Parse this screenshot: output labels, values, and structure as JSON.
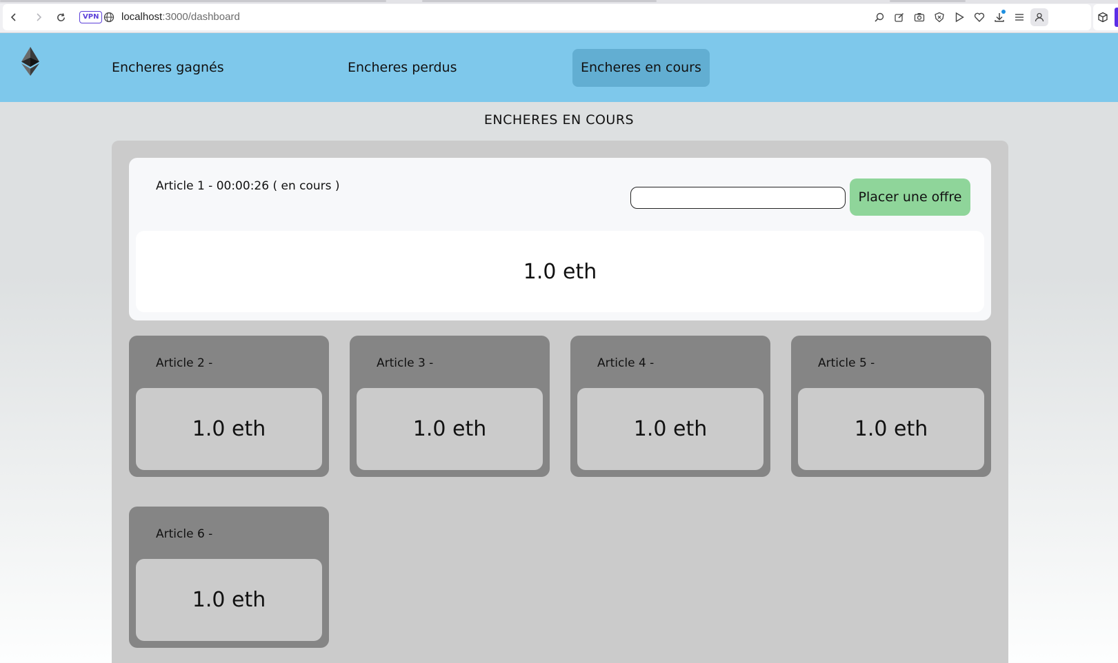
{
  "browser": {
    "url_host": "localhost",
    "url_path": ":3000/dashboard",
    "vpn_label": "VPN",
    "toolbar_icons": [
      "zoom-icon",
      "edit-icon",
      "screenshot-icon",
      "shield-icon",
      "play-icon",
      "heart-icon",
      "download-icon",
      "menu-icon",
      "profile-icon"
    ]
  },
  "nav": {
    "logo": "ethereum-logo",
    "links": [
      {
        "label": "Encheres gagnés",
        "active": false
      },
      {
        "label": "Encheres perdus",
        "active": false
      },
      {
        "label": "Encheres en cours",
        "active": true
      }
    ]
  },
  "page": {
    "title": "ENCHERES EN COURS"
  },
  "featured": {
    "title": "Article 1 - 00:00:26 ( en cours )",
    "input_value": "",
    "button_label": "Placer une offre",
    "price": "1.0 eth"
  },
  "articles": [
    {
      "title": "Article 2 -",
      "price": "1.0 eth"
    },
    {
      "title": "Article 3 -",
      "price": "1.0 eth"
    },
    {
      "title": "Article 4 -",
      "price": "1.0 eth"
    },
    {
      "title": "Article 5 -",
      "price": "1.0 eth"
    },
    {
      "title": "Article 6 -",
      "price": "1.0 eth"
    }
  ]
}
